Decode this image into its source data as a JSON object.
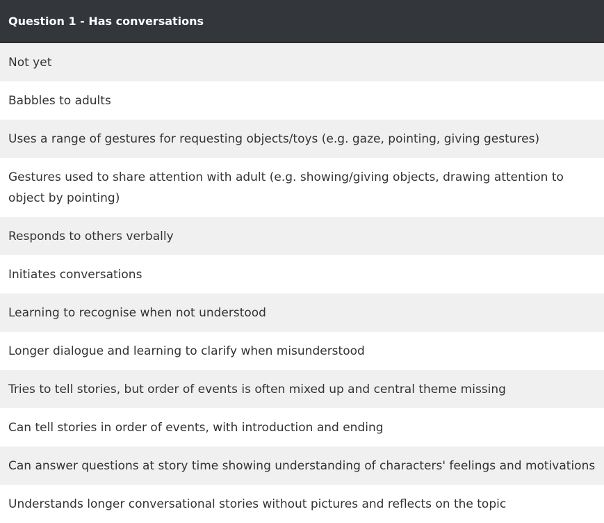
{
  "question": {
    "title": "Question 1 - Has conversations"
  },
  "options": [
    "Not yet",
    "Babbles to adults",
    "Uses a range of gestures for requesting objects/toys (e.g. gaze, pointing, giving gestures)",
    "Gestures used to share attention with adult (e.g. showing/giving objects, drawing attention to object by pointing)",
    "Responds to others verbally",
    "Initiates conversations",
    "Learning to recognise when not understood",
    "Longer dialogue and learning to clarify when misunderstood",
    "Tries to tell stories, but order of events is often mixed up and central theme missing",
    "Can tell stories in order of events, with introduction and ending",
    "Can answer questions at story time showing understanding of characters' feelings and motivations",
    "Understands longer conversational stories without pictures and reflects on the topic"
  ],
  "colors": {
    "header_bg": "#33363b",
    "header_text": "#ffffff",
    "row_odd": "#f0f0f0",
    "row_even": "#ffffff",
    "row_text": "#333333"
  }
}
